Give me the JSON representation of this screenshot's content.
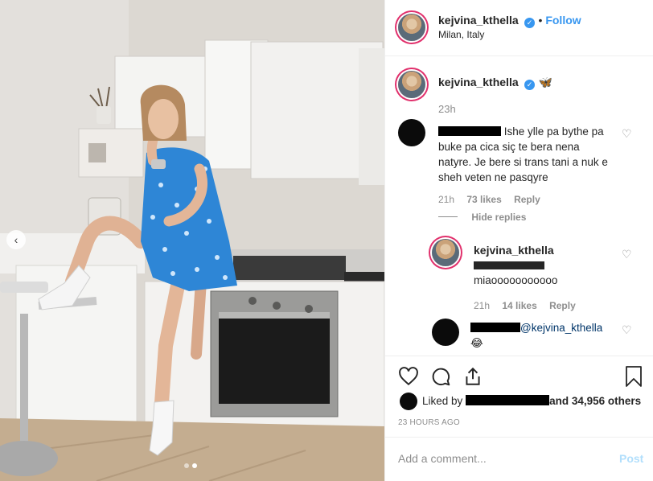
{
  "header": {
    "username": "kejvina_kthella",
    "follow_label": "Follow",
    "location": "Milan, Italy"
  },
  "caption": {
    "username": "kejvina_kthella",
    "text": "🦋",
    "time": "23h"
  },
  "comments": [
    {
      "text": "Ishe ylle pa bythe pa buke pa cica siç te bera nena natyre. Je bere si trans tani a nuk e sheh veten ne pasqyre",
      "time": "21h",
      "likes": "73 likes",
      "reply_label": "Reply",
      "hide_replies": "Hide replies"
    }
  ],
  "replies": [
    {
      "username": "kejvina_kthella",
      "text": "miaooooooooooo",
      "time": "21h",
      "likes": "14 likes",
      "reply_label": "Reply"
    },
    {
      "mention": "@kejvina_kthella",
      "emoji": "😂"
    }
  ],
  "likes": {
    "prefix": "Liked by",
    "suffix": "and 34,956 others"
  },
  "timestamp": "23 HOURS AGO",
  "add_comment": {
    "placeholder": "Add a comment...",
    "post_label": "Post"
  },
  "icons": {
    "heart": "heart-icon",
    "comment": "comment-icon",
    "share": "share-icon",
    "bookmark": "bookmark-icon"
  },
  "colors": {
    "accent": "#3897f0",
    "dress": "#2e86d6"
  }
}
